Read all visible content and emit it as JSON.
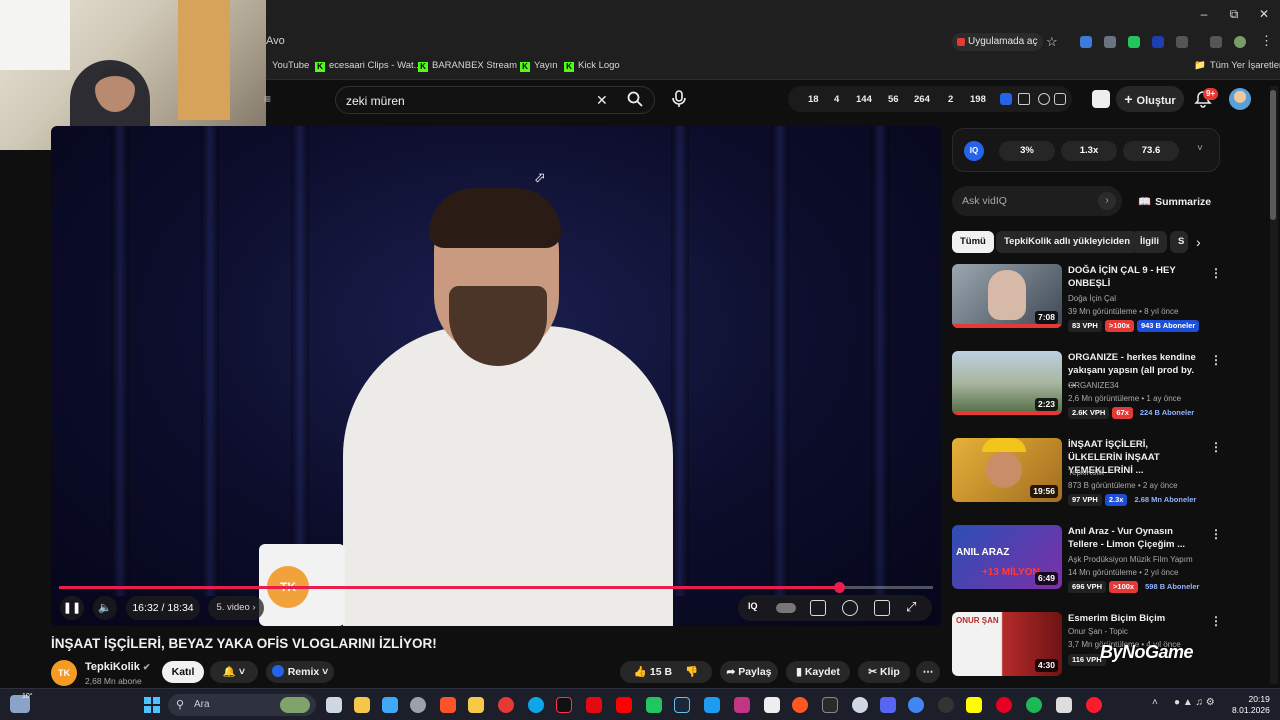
{
  "browser": {
    "address_fragment": "Avo",
    "open_in_app_label": "Uygulamada aç",
    "bookmarks": [
      "YouTube",
      "ecesaari Clips - Wat...",
      "BARANBEX Stream -...",
      "Yayın",
      "Kick Logo"
    ],
    "all_bookmarks_label": "Tüm Yer İşaretleri"
  },
  "youtube": {
    "search_value": "zeki müren",
    "stats": [
      "18",
      "4",
      "144",
      "56",
      "264",
      "2",
      "198"
    ],
    "create_label": "Oluştur",
    "notif_badge": "9+"
  },
  "player": {
    "time": "16:32 / 18:34",
    "chapter": "5. video",
    "progress_fraction": 0.893
  },
  "video": {
    "title": "İNŞAAT İŞÇİLERİ, BEYAZ YAKA OFİS VLOGLARINI İZLİYOR!",
    "channel_avatar_text": "TK",
    "channel_name": "TepkiKolik",
    "subscribers": "2,68 Mn abone",
    "join_label": "Katıl",
    "remix_label": "Remix",
    "likes": "15 B",
    "share_label": "Paylaş",
    "save_label": "Kaydet",
    "clip_label": "Klip"
  },
  "vidiq": {
    "logo": "IQ",
    "metrics": [
      "3%",
      "1.3x",
      "73.6"
    ],
    "ask_placeholder": "Ask vidIQ",
    "summarize_label": "Summarize"
  },
  "chips": [
    "Tümü",
    "TepkiKolik adlı yükleyiciden",
    "İlgili",
    "S"
  ],
  "recommendations": [
    {
      "title": "DOĞA İÇİN ÇAL 9 - HEY ONBEŞLİ",
      "channel": "Doğa İçin Çal",
      "meta": "39 Mn görüntüleme • 8 yıl önce",
      "duration": "7:08",
      "vph": "83 VPH",
      "mult": ">100x",
      "subs": "943 B Aboneler",
      "color": "#8c9aa6"
    },
    {
      "title": "ORGANIZE - herkes kendine yakışanı yapsın (all prod by. ...",
      "channel": "ORGANIZE34",
      "meta": "2,6 Mn görüntüleme • 1 ay önce",
      "duration": "2:23",
      "vph": "2.6K VPH",
      "mult": "67x",
      "subs": "224 B Aboneler",
      "color": "#5d7a59"
    },
    {
      "title": "İNŞAAT İŞÇİLERİ, ÜLKELERİN İNŞAAT YEMEKLERİNİ ...",
      "channel": "TepkiKolik",
      "meta": "873 B görüntüleme • 2 ay önce",
      "duration": "19:56",
      "vph": "97 VPH",
      "mult": "2.3x",
      "subs": "2.68 Mn Aboneler",
      "color": "#d7a23a"
    },
    {
      "title": "Anıl Araz - Vur Oynasın Tellere - Limon Çiçeğim ...",
      "channel": "Aşk Prodüksiyon Müzik Film Yapım",
      "meta": "14 Mn görüntüleme • 2 yıl önce",
      "duration": "6:49",
      "vph": "696 VPH",
      "mult": ">100x",
      "subs": "598 B Aboneler",
      "color": "#3b5bb5",
      "overlay": "ANIL ARAZ",
      "overlay2": "+13 MİLYON"
    },
    {
      "title": "Esmerim Biçim Biçim",
      "channel": "Onur Şan - Topic",
      "meta": "3,7 Mn görüntüleme • 4 yıl önce",
      "duration": "4:30",
      "vph": "116 VPH",
      "mult": "",
      "subs": "",
      "color": "#b52a2a",
      "overlay": "ONUR ŞAN"
    }
  ],
  "watermark": "ByNoGame",
  "taskbar": {
    "search_label": "Ara",
    "temp": "10°",
    "time": "20:19",
    "date": "8.01.2026"
  }
}
